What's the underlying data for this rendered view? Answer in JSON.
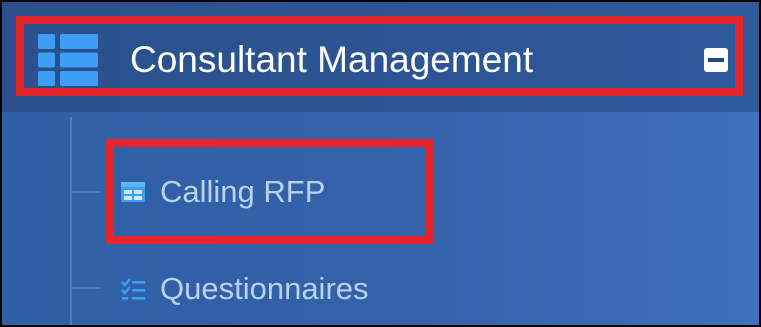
{
  "sidebar": {
    "section": {
      "icon": "grid-list-icon",
      "title": "Consultant Management",
      "toggle_icon": "minus-square-icon"
    },
    "items": [
      {
        "icon": "table-icon",
        "label": "Calling RFP"
      },
      {
        "icon": "checklist-icon",
        "label": "Questionnaires"
      }
    ]
  },
  "colors": {
    "sidebar_bg": "#3462ab",
    "header_bg": "#2d5595",
    "highlight_border": "#e3242b",
    "icon_blue": "#3e9ef5",
    "item_text": "#b9d2ee"
  }
}
